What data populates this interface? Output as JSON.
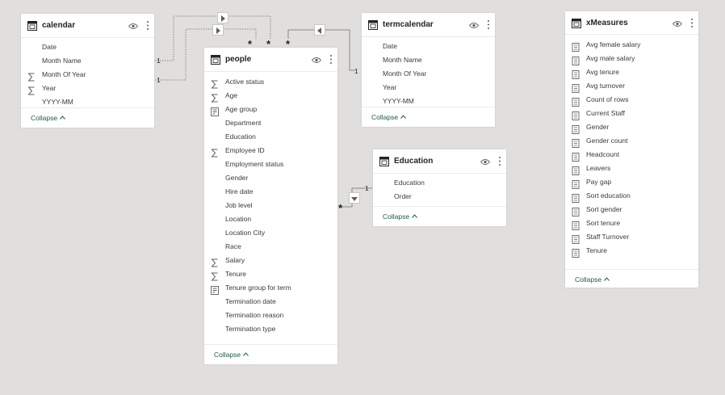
{
  "tables": {
    "calendar": {
      "title": "calendar",
      "fields": [
        {
          "label": "Date",
          "icon": "none"
        },
        {
          "label": "Month Name",
          "icon": "none"
        },
        {
          "label": "Month Of Year",
          "icon": "sigma"
        },
        {
          "label": "Year",
          "icon": "sigma"
        },
        {
          "label": "YYYY-MM",
          "icon": "none"
        }
      ],
      "collapse_label": "Collapse"
    },
    "termcalendar": {
      "title": "termcalendar",
      "fields": [
        {
          "label": "Date",
          "icon": "none"
        },
        {
          "label": "Month Name",
          "icon": "none"
        },
        {
          "label": "Month Of Year",
          "icon": "none"
        },
        {
          "label": "Year",
          "icon": "none"
        },
        {
          "label": "YYYY-MM",
          "icon": "none"
        }
      ],
      "collapse_label": "Collapse"
    },
    "people": {
      "title": "people",
      "fields": [
        {
          "label": "Active status",
          "icon": "sigma"
        },
        {
          "label": "Age",
          "icon": "sigma"
        },
        {
          "label": "Age group",
          "icon": "group"
        },
        {
          "label": "Department",
          "icon": "none"
        },
        {
          "label": "Education",
          "icon": "none"
        },
        {
          "label": "Employee ID",
          "icon": "sigma"
        },
        {
          "label": "Employment status",
          "icon": "none"
        },
        {
          "label": "Gender",
          "icon": "none"
        },
        {
          "label": "Hire date",
          "icon": "none"
        },
        {
          "label": "Job level",
          "icon": "none"
        },
        {
          "label": "Location",
          "icon": "none"
        },
        {
          "label": "Location City",
          "icon": "none"
        },
        {
          "label": "Race",
          "icon": "none"
        },
        {
          "label": "Salary",
          "icon": "sigma"
        },
        {
          "label": "Tenure",
          "icon": "sigma"
        },
        {
          "label": "Tenure group for term",
          "icon": "group"
        },
        {
          "label": "Termination date",
          "icon": "none"
        },
        {
          "label": "Termination reason",
          "icon": "none"
        },
        {
          "label": "Termination type",
          "icon": "none"
        }
      ],
      "collapse_label": "Collapse"
    },
    "education": {
      "title": "Education",
      "fields": [
        {
          "label": "Education",
          "icon": "none"
        },
        {
          "label": "Order",
          "icon": "none"
        }
      ],
      "collapse_label": "Collapse"
    },
    "xmeasures": {
      "title": "xMeasures",
      "fields": [
        {
          "label": "Avg female salary",
          "icon": "measure"
        },
        {
          "label": "Avg male salary",
          "icon": "measure"
        },
        {
          "label": "Avg tenure",
          "icon": "measure"
        },
        {
          "label": "Avg turnover",
          "icon": "measure"
        },
        {
          "label": "Count of rows",
          "icon": "measure"
        },
        {
          "label": "Current Staff",
          "icon": "measure"
        },
        {
          "label": "Gender",
          "icon": "measure"
        },
        {
          "label": "Gender count",
          "icon": "measure"
        },
        {
          "label": "Headcount",
          "icon": "measure"
        },
        {
          "label": "Leavers",
          "icon": "measure"
        },
        {
          "label": "Pay gap",
          "icon": "measure"
        },
        {
          "label": "Sort education",
          "icon": "measure"
        },
        {
          "label": "Sort gender",
          "icon": "measure"
        },
        {
          "label": "Sort tenure",
          "icon": "measure"
        },
        {
          "label": "Staff Turnover",
          "icon": "measure"
        },
        {
          "label": "Tenure",
          "icon": "measure"
        }
      ],
      "collapse_label": "Collapse"
    }
  },
  "relationships": {
    "one": "1",
    "many": "*"
  },
  "colors": {
    "background": "#e1dfdd",
    "card": "#ffffff",
    "line": "#8a8886",
    "collapse_link": "#1a5c4c"
  }
}
